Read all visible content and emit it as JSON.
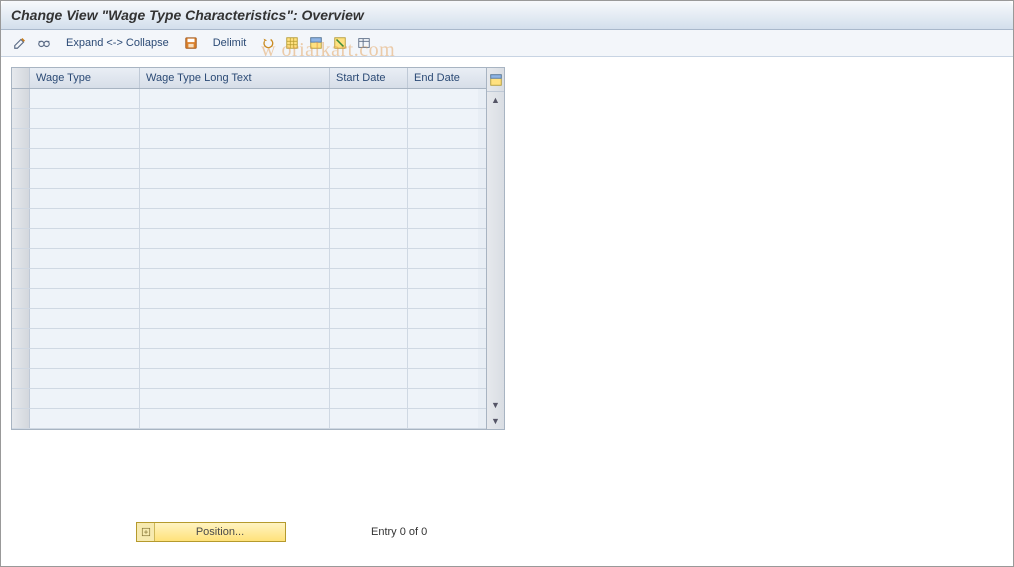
{
  "title": "Change View \"Wage Type Characteristics\": Overview",
  "toolbar": {
    "expand_collapse_label": "Expand <-> Collapse",
    "delimit_label": "Delimit"
  },
  "grid": {
    "columns": {
      "wage_type": "Wage Type",
      "wage_type_long_text": "Wage Type Long Text",
      "start_date": "Start Date",
      "end_date": "End Date"
    },
    "row_count": 17
  },
  "footer": {
    "position_label": "Position...",
    "entry_text": "Entry 0 of 0"
  },
  "watermark": "w     orialkart.com"
}
